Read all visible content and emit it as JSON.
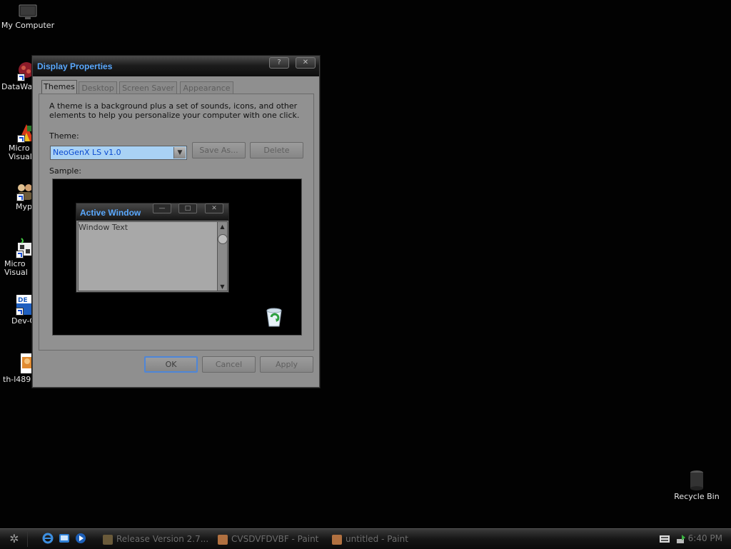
{
  "desktop": {
    "icons": [
      {
        "label": "My Computer"
      },
      {
        "label": "DataWa"
      },
      {
        "label": "Micro\nVisual"
      },
      {
        "label": "Myp"
      },
      {
        "label": "Micro\nVisual"
      },
      {
        "label": "Dev-C"
      },
      {
        "label": "th-l489"
      },
      {
        "label": "Recycle Bin"
      }
    ]
  },
  "dialog": {
    "title": "Display Properties",
    "help_button": "?",
    "close_button": "✕",
    "tabs": [
      "Themes",
      "Desktop",
      "Screen Saver",
      "Appearance"
    ],
    "active_tab": "Themes",
    "description": "A theme is a background plus a set of sounds, icons, and other elements to help you personalize your computer with one click.",
    "theme_label": "Theme:",
    "theme_value": "NeoGenX LS v1.0",
    "save_as_label": "Save As...",
    "delete_label": "Delete",
    "sample_label": "Sample:",
    "sample_window": {
      "title": "Active Window",
      "text": "Window Text"
    },
    "ok_label": "OK",
    "cancel_label": "Cancel",
    "apply_label": "Apply"
  },
  "taskbar": {
    "tasks": [
      "Release Version 2.7...",
      "CVSDVFDVBF - Paint",
      "untitled - Paint"
    ],
    "clock": "6:40 PM"
  },
  "colors": {
    "accent": "#5aa9ff",
    "desktop_bg": "#020202",
    "dialog_bg": "#8f8f8f",
    "selection_bg": "#a9d2f5"
  }
}
